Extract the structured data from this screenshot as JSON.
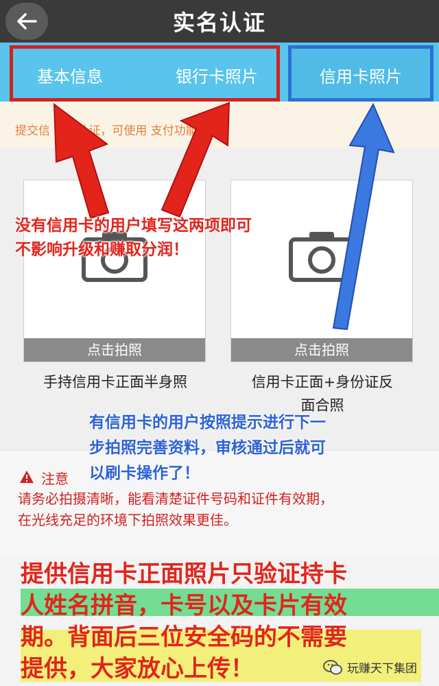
{
  "header": {
    "title": "实名认证",
    "back_icon": "arrow-left-icon"
  },
  "tabs": {
    "basic": "基本信息",
    "bank": "银行卡照片",
    "credit": "信用卡照片"
  },
  "notice": "提交信    实名认证，可使用    支付功能。",
  "photos": {
    "shoot_label": "点击拍照",
    "left_label": "手持信用卡正面半身照",
    "right_label_line1": "信用卡正面+身份证反",
    "right_label_line2": "面合照"
  },
  "annotations": {
    "red_line1": "没有信用卡的用户填写这两项即可",
    "red_line2": "不影响升级和赚取分润！",
    "blue_line1": "有信用卡的用户按照提示进行下一",
    "blue_line2": "步拍照完善资料，审核通过后就可",
    "blue_line3": "以刷卡操作了！"
  },
  "warning": {
    "title": "注意",
    "line1": "请务必拍摄清晰，能看清楚证件号码和证件有效期，",
    "line2": "在光线充足的环境下拍照效果更佳。"
  },
  "bottom_note": {
    "line1": "提供信用卡正面照片只验证持卡",
    "line2": "人姓名拼音，卡号以及卡片有效",
    "line3": "期。背面后三位安全码的不需要",
    "line4": "提供，大家放心上传！"
  },
  "watermark": "玩赚天下集团",
  "colors": {
    "header_bg": "#3a3a3a",
    "tab_bg": "#59c4ec",
    "red": "#d42020",
    "blue": "#2e6fd4",
    "highlight_green": "#74dc93",
    "highlight_yellow": "#f2f07a"
  }
}
